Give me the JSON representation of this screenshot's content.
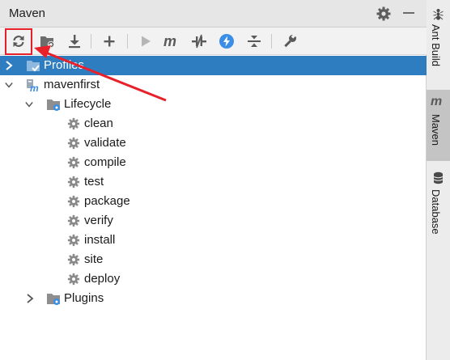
{
  "panel": {
    "title": "Maven"
  },
  "toolbar": {
    "buttons": [
      {
        "name": "reload-all-maven-projects",
        "icon": "reload-icon"
      },
      {
        "name": "generate-sources-and-update-folders",
        "icon": "folder-generate-icon"
      },
      {
        "name": "download-sources",
        "icon": "download-icon"
      },
      {
        "name": "add-maven-projects",
        "icon": "plus-icon"
      },
      {
        "name": "run-maven-build",
        "icon": "run-icon"
      },
      {
        "name": "execute-maven-goal",
        "icon": "maven-m-icon"
      },
      {
        "name": "toggle-offline-mode",
        "icon": "offline-icon"
      },
      {
        "name": "toggle-skip-tests-mode",
        "icon": "lightning-icon"
      },
      {
        "name": "collapse-all",
        "icon": "collapse-icon"
      },
      {
        "name": "maven-settings",
        "icon": "wrench-icon"
      }
    ]
  },
  "tree": {
    "profiles": "Profiles",
    "project": "mavenfirst",
    "lifecycle": "Lifecycle",
    "goals": [
      "clean",
      "validate",
      "compile",
      "test",
      "package",
      "verify",
      "install",
      "site",
      "deploy"
    ],
    "plugins": "Plugins"
  },
  "sidebar": {
    "tabs": [
      {
        "label": "Ant Build",
        "icon": "ant-icon"
      },
      {
        "label": "Maven",
        "icon": "maven-m-icon",
        "active": true
      },
      {
        "label": "Database",
        "icon": "database-icon"
      }
    ]
  },
  "colors": {
    "selection": "#2e7dc0",
    "highlight": "#e8202a",
    "accent_blue": "#3a8ee6"
  }
}
